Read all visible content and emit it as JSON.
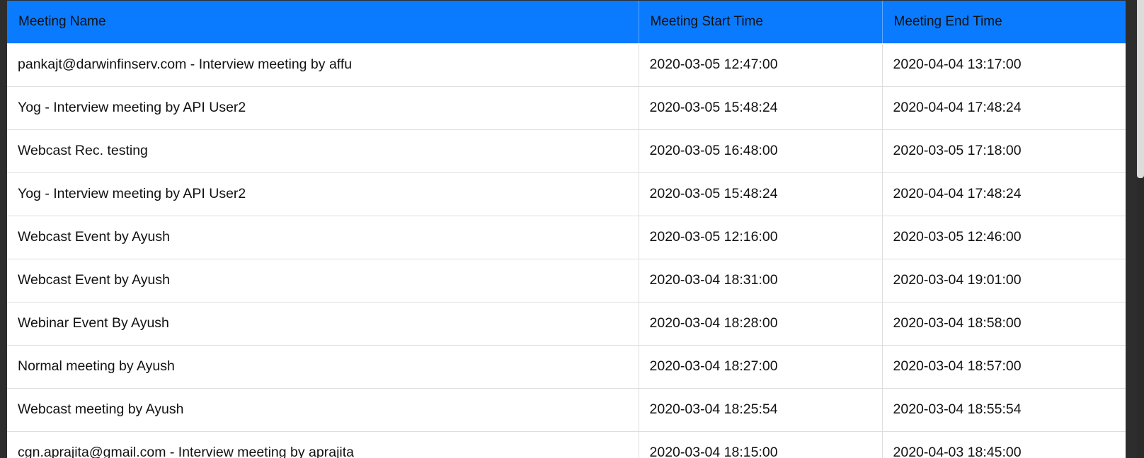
{
  "table": {
    "headers": [
      "Meeting Name",
      "Meeting Start Time",
      "Meeting End Time"
    ],
    "rows": [
      {
        "name": "pankajt@darwinfinserv.com - Interview meeting by affu",
        "start": "2020-03-05 12:47:00",
        "end": "2020-04-04 13:17:00"
      },
      {
        "name": "Yog - Interview meeting by API User2",
        "start": "2020-03-05 15:48:24",
        "end": "2020-04-04 17:48:24"
      },
      {
        "name": "Webcast Rec. testing",
        "start": "2020-03-05 16:48:00",
        "end": "2020-03-05 17:18:00"
      },
      {
        "name": "Yog - Interview meeting by API User2",
        "start": "2020-03-05 15:48:24",
        "end": "2020-04-04 17:48:24"
      },
      {
        "name": "Webcast Event by Ayush",
        "start": "2020-03-05 12:16:00",
        "end": "2020-03-05 12:46:00"
      },
      {
        "name": "Webcast Event by Ayush",
        "start": "2020-03-04 18:31:00",
        "end": "2020-03-04 19:01:00"
      },
      {
        "name": "Webinar Event By Ayush",
        "start": "2020-03-04 18:28:00",
        "end": "2020-03-04 18:58:00"
      },
      {
        "name": "Normal meeting by Ayush",
        "start": "2020-03-04 18:27:00",
        "end": "2020-03-04 18:57:00"
      },
      {
        "name": "Webcast meeting by Ayush",
        "start": "2020-03-04 18:25:54",
        "end": "2020-03-04 18:55:54"
      },
      {
        "name": "cgn.aprajita@gmail.com - Interview meeting by aprajita",
        "start": "2020-03-04 18:15:00",
        "end": "2020-04-03 18:45:00"
      }
    ]
  },
  "colors": {
    "header_bg": "#0a7bff",
    "header_text": "#111111",
    "row_border": "#dedede",
    "page_bg": "#2d2d2d"
  }
}
